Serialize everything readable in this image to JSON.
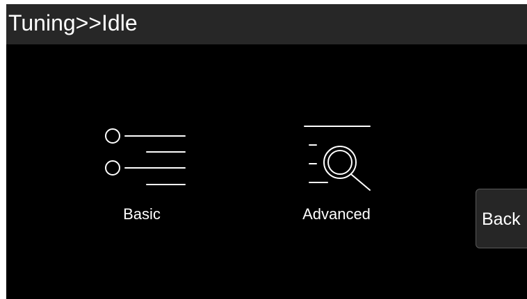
{
  "header": {
    "title": "Tuning>>Idle"
  },
  "tiles": [
    {
      "label": "Basic",
      "icon": "list-options-icon"
    },
    {
      "label": "Advanced",
      "icon": "search-list-icon"
    }
  ],
  "back_button": {
    "label": "Back"
  },
  "colors": {
    "background": "#000000",
    "title_bar": "#272727",
    "text": "#ffffff",
    "icon_stroke": "#ffffff",
    "button_bg": "#262626",
    "button_border": "#5a5a5a"
  }
}
